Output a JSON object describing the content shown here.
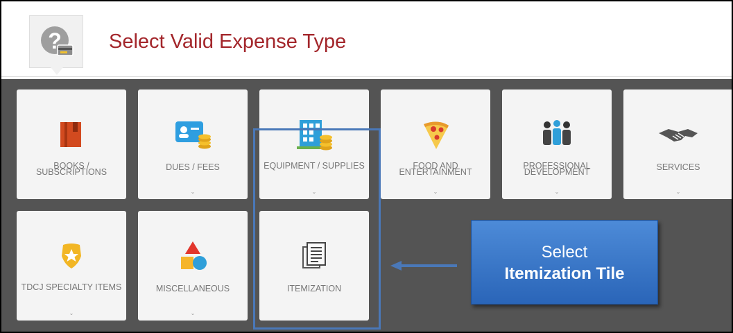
{
  "header": {
    "title": "Select Valid Expense Type",
    "help_icon": "help-card-icon"
  },
  "tiles": [
    {
      "label": "BOOKS / SUBSCRIPTIONS",
      "icon": "book-icon"
    },
    {
      "label": "DUES / FEES",
      "icon": "id-card-coins-icon"
    },
    {
      "label": "EQUIPMENT / SUPPLIES",
      "icon": "building-coins-icon"
    },
    {
      "label": "FOOD AND ENTERTAINMENT",
      "icon": "pizza-icon"
    },
    {
      "label": "PROFESSIONAL DEVELOPMENT",
      "icon": "people-icon"
    },
    {
      "label": "SERVICES",
      "icon": "handshake-icon"
    },
    {
      "label": "TDCJ SPECIALTY ITEMS",
      "icon": "badge-icon"
    },
    {
      "label": "MISCELLANEOUS",
      "icon": "shapes-icon"
    },
    {
      "label": "ITEMIZATION",
      "icon": "document-icon"
    }
  ],
  "chevron": "⌄",
  "callout": {
    "line1": "Select",
    "line2": "Itemization Tile"
  },
  "colors": {
    "title": "#a3262b",
    "background": "#545454",
    "tile": "#f4f4f4",
    "accent": "#4a78b8"
  }
}
